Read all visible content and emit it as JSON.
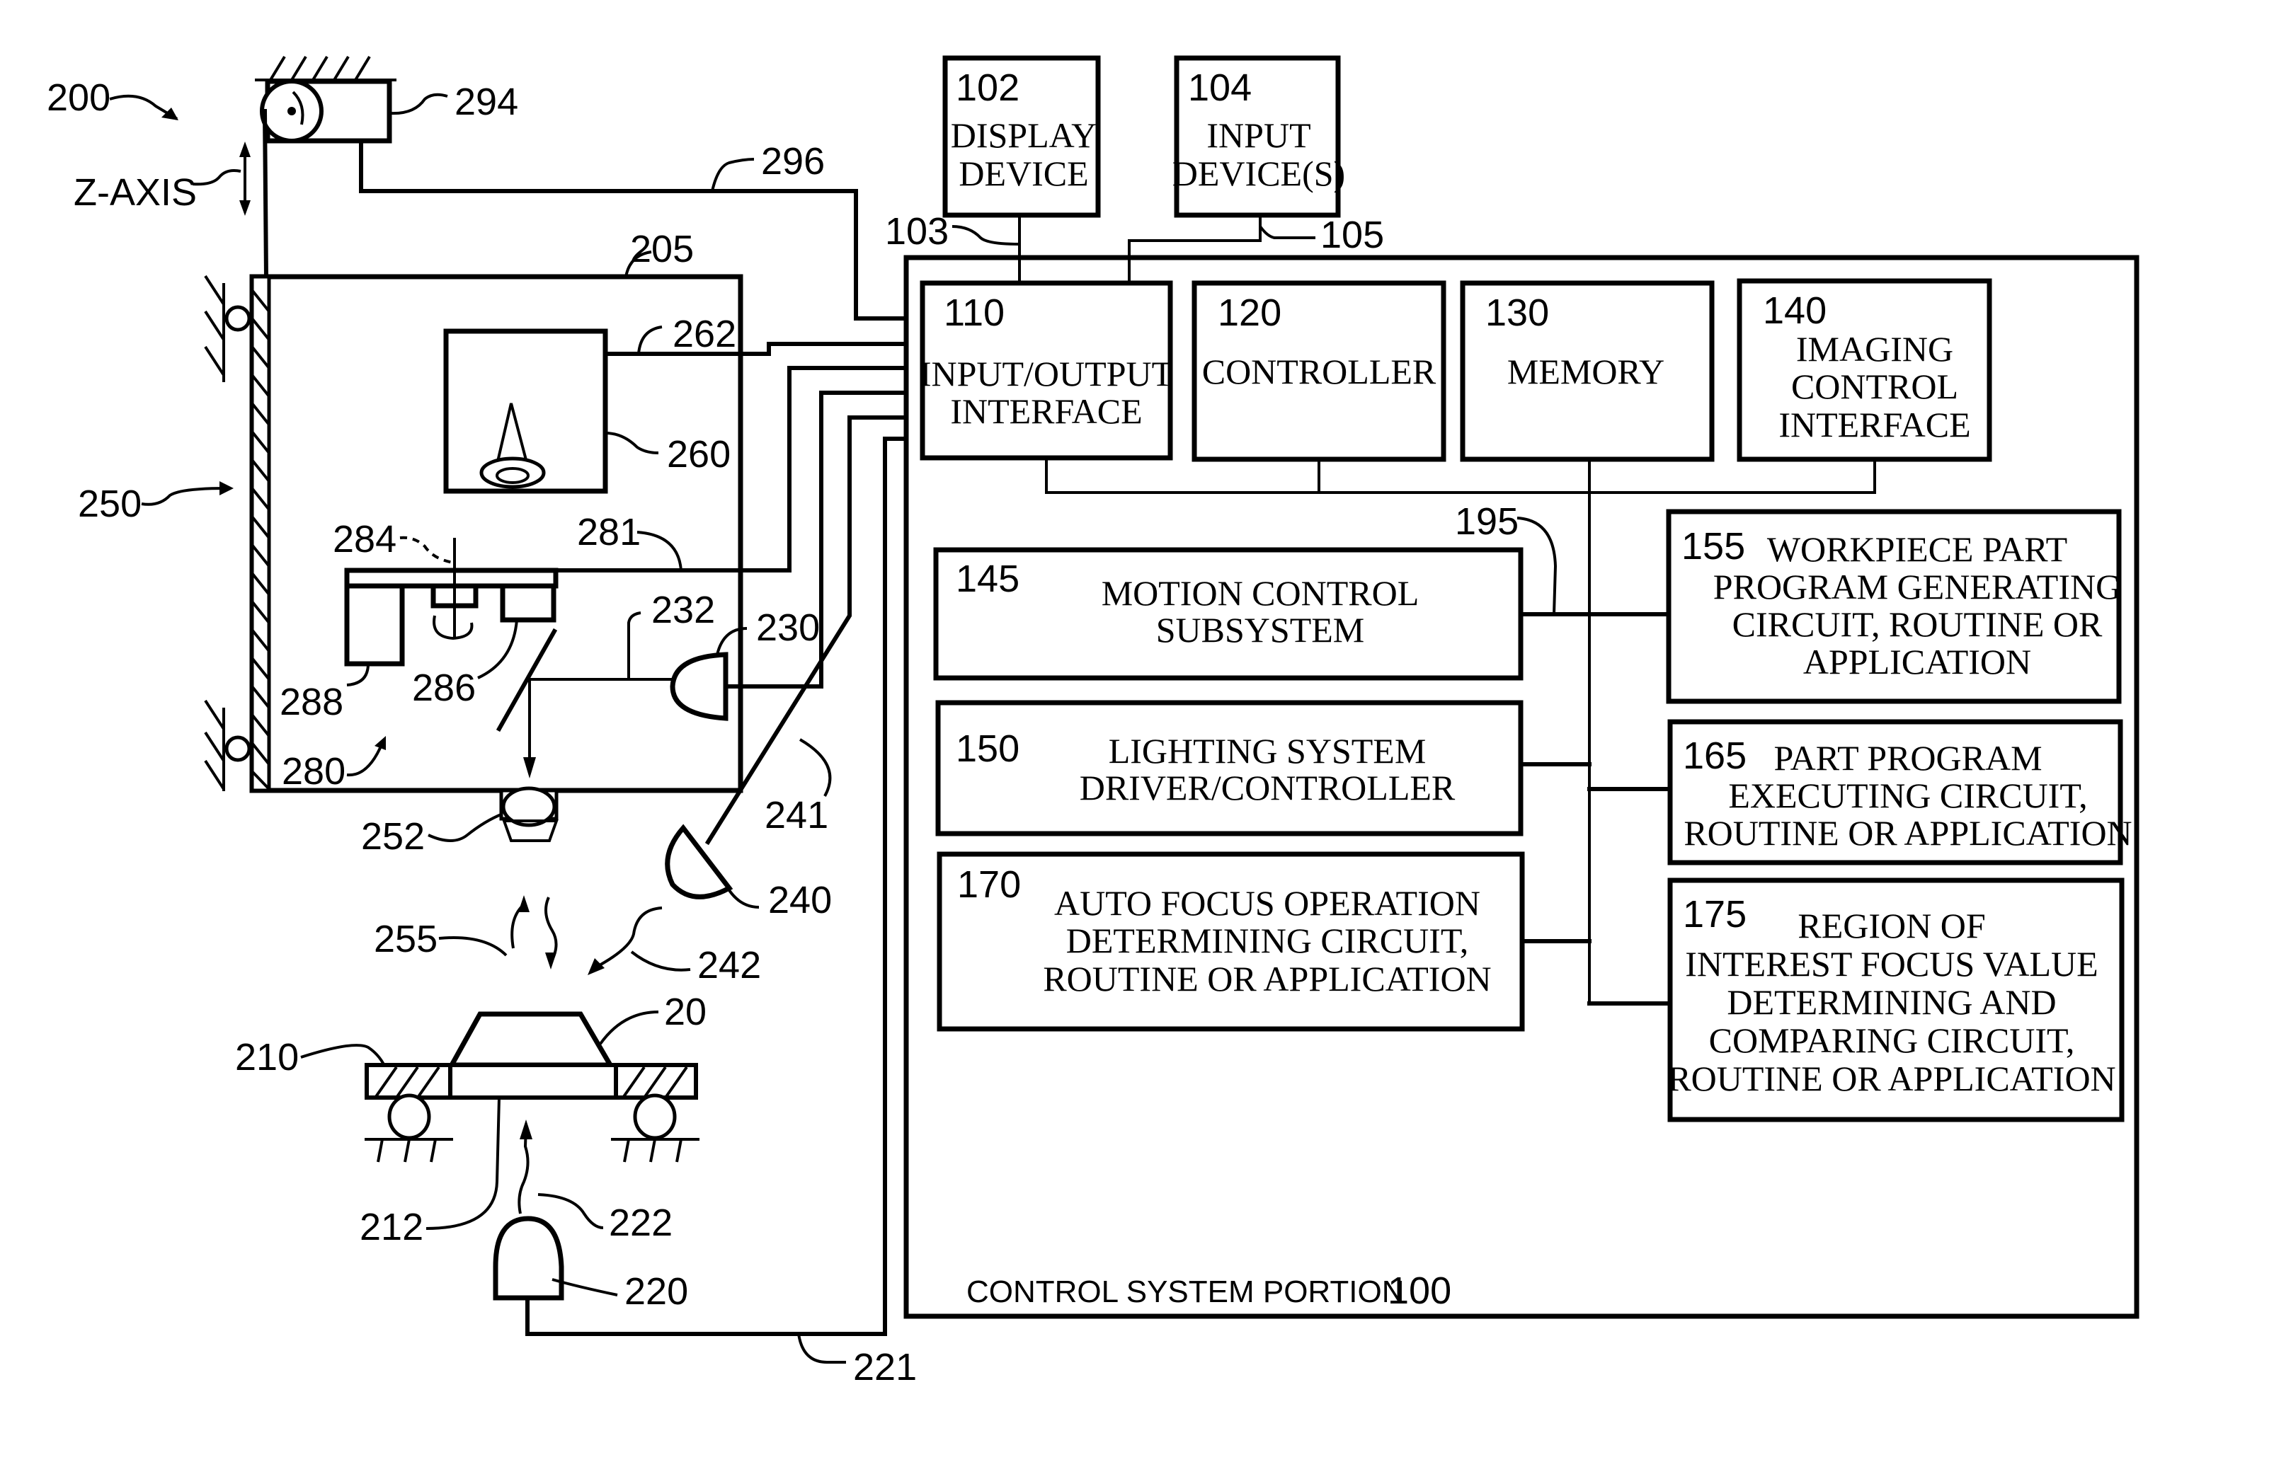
{
  "figure": {
    "system_ref": "200",
    "z_axis_label": "Z-AXIS",
    "control_system": {
      "label": "CONTROL SYSTEM PORTION",
      "ref": "100"
    },
    "blocks": [
      {
        "id": "display",
        "ref": "102",
        "lines": [
          "DISPLAY",
          "DEVICE"
        ]
      },
      {
        "id": "input",
        "ref": "104",
        "lines": [
          "INPUT",
          "DEVICE(S)"
        ]
      },
      {
        "id": "io",
        "ref": "110",
        "lines": [
          "INPUT/OUTPUT",
          "INTERFACE"
        ]
      },
      {
        "id": "controller",
        "ref": "120",
        "lines": [
          "CONTROLLER"
        ]
      },
      {
        "id": "memory",
        "ref": "130",
        "lines": [
          "MEMORY"
        ]
      },
      {
        "id": "imaging",
        "ref": "140",
        "lines": [
          "IMAGING",
          "CONTROL",
          "INTERFACE"
        ]
      },
      {
        "id": "motion",
        "ref": "145",
        "lines": [
          "MOTION CONTROL",
          "SUBSYSTEM"
        ]
      },
      {
        "id": "lighting",
        "ref": "150",
        "lines": [
          "LIGHTING SYSTEM",
          "DRIVER/CONTROLLER"
        ]
      },
      {
        "id": "autofocus",
        "ref": "170",
        "lines": [
          "AUTO FOCUS OPERATION",
          "DETERMINING CIRCUIT,",
          "ROUTINE OR APPLICATION"
        ]
      },
      {
        "id": "workpiece",
        "ref": "155",
        "lines": [
          "WORKPIECE PART",
          "PROGRAM GENERATING",
          "CIRCUIT, ROUTINE OR",
          "APPLICATION"
        ]
      },
      {
        "id": "executing",
        "ref": "165",
        "lines": [
          "PART PROGRAM",
          "EXECUTING CIRCUIT,",
          "ROUTINE OR APPLICATION"
        ]
      },
      {
        "id": "roi",
        "ref": "175",
        "lines": [
          "REGION OF",
          "INTEREST FOCUS VALUE",
          "DETERMINING AND",
          "COMPARING CIRCUIT,",
          "ROUTINE OR APPLICATION"
        ]
      }
    ],
    "refs": {
      "r294": "294",
      "r296": "296",
      "r205": "205",
      "r262": "262",
      "r260": "260",
      "r250": "250",
      "r284": "284",
      "r281": "281",
      "r232": "232",
      "r230": "230",
      "r288": "288",
      "r286": "286",
      "r280": "280",
      "r252": "252",
      "r241": "241",
      "r240": "240",
      "r255": "255",
      "r242": "242",
      "r20": "20",
      "r210": "210",
      "r212": "212",
      "r222": "222",
      "r220": "220",
      "r221": "221",
      "r103": "103",
      "r105": "105",
      "r195": "195"
    }
  }
}
